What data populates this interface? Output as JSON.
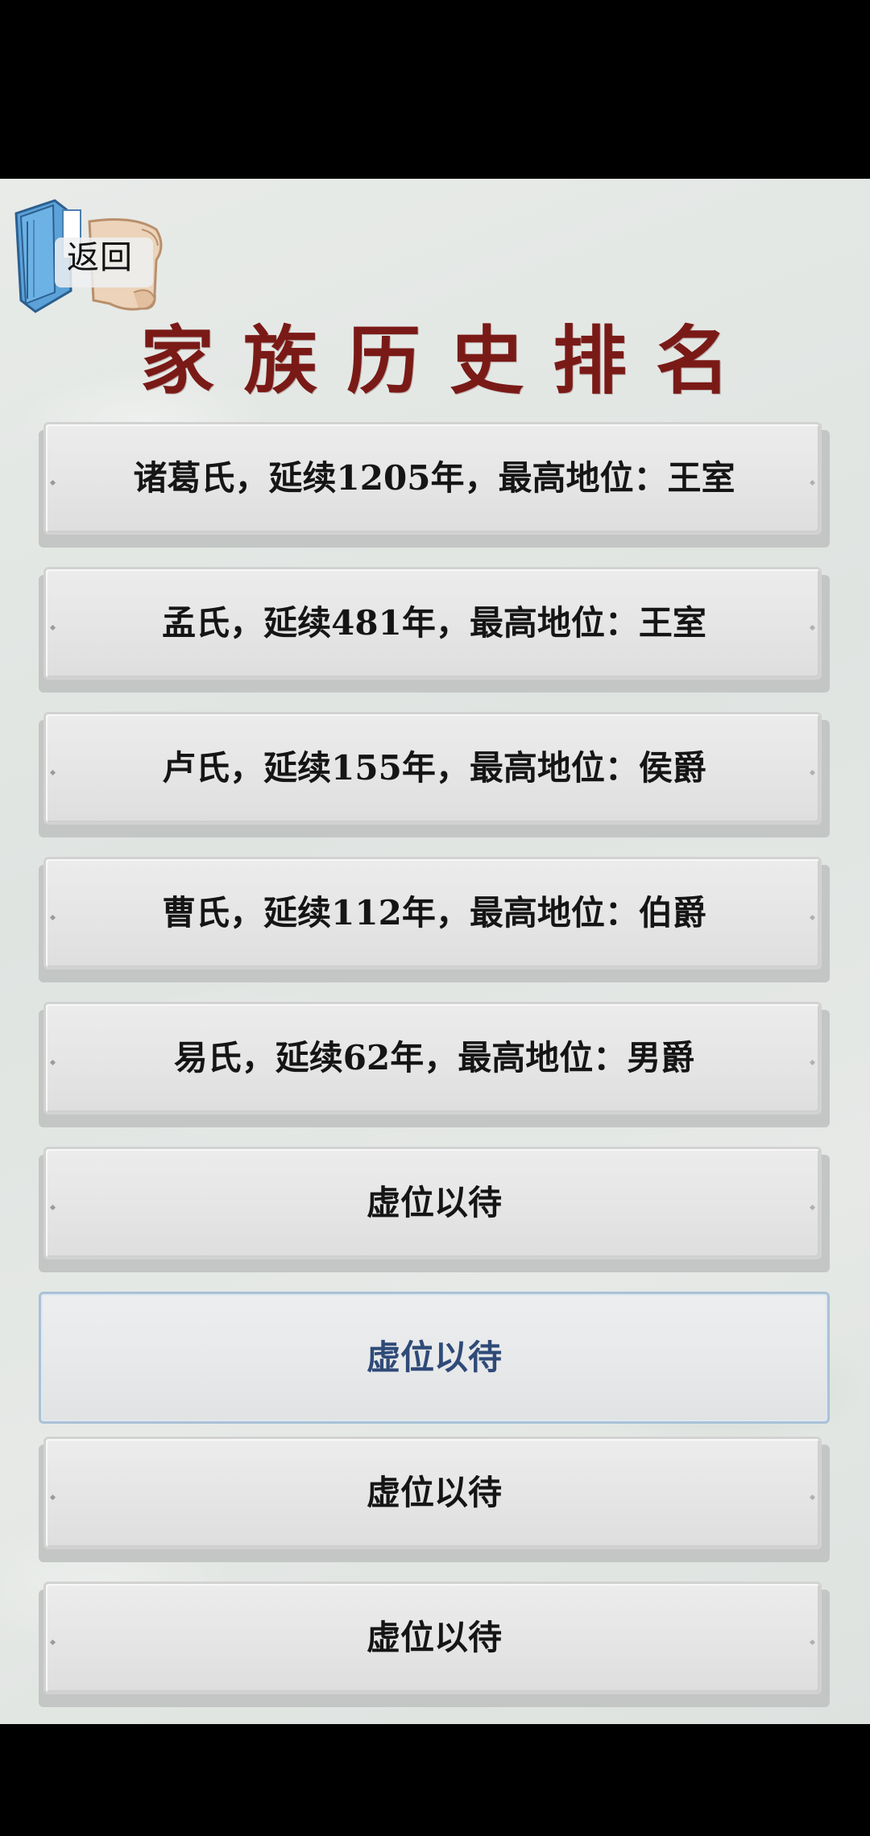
{
  "back_button": {
    "label": "返回"
  },
  "title": "家族历史排名",
  "rankings": [
    {
      "text": "诸葛氏，延续1205年，最高地位：王室"
    },
    {
      "text": "孟氏，延续481年，最高地位：王室"
    },
    {
      "text": "卢氏，延续155年，最高地位：侯爵"
    },
    {
      "text": "曹氏，延续112年，最高地位：伯爵"
    },
    {
      "text": "易氏，延续62年，最高地位：男爵"
    },
    {
      "text": "虚位以待"
    },
    {
      "text": "虚位以待",
      "selected": true
    },
    {
      "text": "虚位以待"
    },
    {
      "text": "虚位以待"
    }
  ],
  "colors": {
    "title": "#7a1a17",
    "selected_text": "#2f4a78",
    "selected_border": "#a9c2d6",
    "book_cover": "#5aa0d6",
    "scroll": "#e9cdb0"
  },
  "icons": {
    "back": "book-scroll-icon"
  }
}
